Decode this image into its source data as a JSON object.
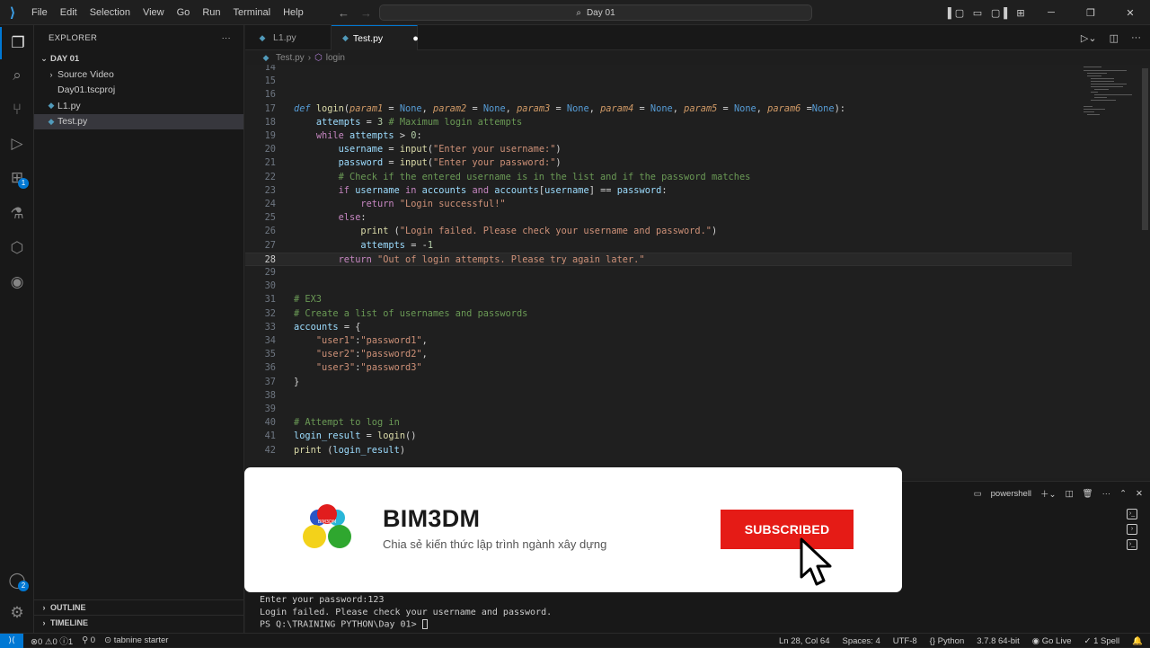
{
  "menu": [
    "File",
    "Edit",
    "Selection",
    "View",
    "Go",
    "Run",
    "Terminal",
    "Help"
  ],
  "command_center": "Day 01",
  "explorer": {
    "title": "EXPLORER",
    "folder": "DAY 01",
    "items": [
      {
        "label": "Source Video",
        "kind": "folder"
      },
      {
        "label": "Day01.tscproj",
        "kind": "file"
      },
      {
        "label": "L1.py",
        "kind": "py"
      },
      {
        "label": "Test.py",
        "kind": "py",
        "selected": true
      }
    ],
    "outline": "OUTLINE",
    "timeline": "TIMELINE"
  },
  "tabs": [
    {
      "label": "L1.py",
      "active": false
    },
    {
      "label": "Test.py",
      "active": true,
      "dirty": true
    }
  ],
  "breadcrumb": {
    "file": "Test.py",
    "symbol": "login"
  },
  "activity_badges": {
    "extensions": "1",
    "accounts": "2"
  },
  "code_lines": [
    {
      "n": "14",
      "html": ""
    },
    {
      "n": "15",
      "html": ""
    },
    {
      "n": "16",
      "html": ""
    },
    {
      "n": "17",
      "html": "<span class='def'>def</span> <span class='fn'>login</span><span class='plain'>(</span><span class='prm'>param1</span> <span class='op'>=</span> <span class='none'>None</span><span class='plain'>, </span><span class='prm'>param2</span> <span class='op'>=</span> <span class='none'>None</span><span class='plain'>, </span><span class='prm'>param3</span> <span class='op'>=</span> <span class='none'>None</span><span class='plain'>, </span><span class='prm'>param4</span> <span class='op'>=</span> <span class='none'>None</span><span class='plain'>, </span><span class='prm'>param5</span> <span class='op'>=</span> <span class='none'>None</span><span class='plain'>, </span><span class='prm'>param6</span> <span class='op'>=</span><span class='none'>None</span><span class='plain'>):</span>"
    },
    {
      "n": "18",
      "html": "    <span class='var'>attempts</span> <span class='op'>=</span> <span class='num'>3</span> <span class='cm'># Maximum login attempts</span>"
    },
    {
      "n": "19",
      "html": "    <span class='kw'>while</span> <span class='var'>attempts</span> <span class='op'>&gt;</span> <span class='num'>0</span><span class='plain'>:</span>"
    },
    {
      "n": "20",
      "html": "        <span class='var'>username</span> <span class='op'>=</span> <span class='fn'>input</span><span class='plain'>(</span><span class='str'>\"Enter your username:\"</span><span class='plain'>)</span>"
    },
    {
      "n": "21",
      "html": "        <span class='var'>password</span> <span class='op'>=</span> <span class='fn'>input</span><span class='plain'>(</span><span class='str'>\"Enter your password:\"</span><span class='plain'>)</span>"
    },
    {
      "n": "22",
      "html": "        <span class='cm'># Check if the entered username is in the list and if the password matches</span>"
    },
    {
      "n": "23",
      "html": "        <span class='kw'>if</span> <span class='var'>username</span> <span class='kw'>in</span> <span class='var'>accounts</span> <span class='kw'>and</span> <span class='var'>accounts</span><span class='plain'>[</span><span class='var'>username</span><span class='plain'>]</span> <span class='op'>==</span> <span class='var'>password</span><span class='plain'>:</span>"
    },
    {
      "n": "24",
      "html": "            <span class='kw'>return</span> <span class='str'>\"Login successful!\"</span>"
    },
    {
      "n": "25",
      "html": "        <span class='kw'>else</span><span class='plain'>:</span>"
    },
    {
      "n": "26",
      "html": "            <span class='fn'>print</span> <span class='plain'>(</span><span class='str'>\"Login failed. Please check your username and password.\"</span><span class='plain'>)</span>"
    },
    {
      "n": "27",
      "html": "            <span class='var'>attempts</span> <span class='op'>=</span> <span class='op'>-</span><span class='num'>1</span>"
    },
    {
      "n": "28",
      "html": "        <span class='kw'>return</span> <span class='str'>\"Out of login attempts. Please try again later.\"</span>",
      "current": true
    },
    {
      "n": "29",
      "html": ""
    },
    {
      "n": "30",
      "html": ""
    },
    {
      "n": "31",
      "html": "<span class='cm'># EX3</span>"
    },
    {
      "n": "32",
      "html": "<span class='cm'># Create a list of usernames and passwords</span>"
    },
    {
      "n": "33",
      "html": "<span class='var'>accounts</span> <span class='op'>=</span> <span class='plain'>{</span>"
    },
    {
      "n": "34",
      "html": "    <span class='str'>\"user1\"</span><span class='plain'>:</span><span class='str'>\"password1\"</span><span class='plain'>,</span>"
    },
    {
      "n": "35",
      "html": "    <span class='str'>\"user2\"</span><span class='plain'>:</span><span class='str'>\"password2\"</span><span class='plain'>,</span>"
    },
    {
      "n": "36",
      "html": "    <span class='str'>\"user3\"</span><span class='plain'>:</span><span class='str'>\"password3\"</span>"
    },
    {
      "n": "37",
      "html": "<span class='plain'>}</span>"
    },
    {
      "n": "38",
      "html": ""
    },
    {
      "n": "39",
      "html": ""
    },
    {
      "n": "40",
      "html": "<span class='cm'># Attempt to log in</span>"
    },
    {
      "n": "41",
      "html": "<span class='var'>login_result</span> <span class='op'>=</span> <span class='fn'>login</span><span class='plain'>()</span>"
    },
    {
      "n": "42",
      "html": "<span class='fn'>print</span> <span class='plain'>(</span><span class='var'>login_result</span><span class='plain'>)</span>"
    }
  ],
  "terminal": {
    "shell": "powershell",
    "lines": [
      "Enter your password:123",
      "Login failed. Please check your username and password.",
      "PS Q:\\TRAINING PYTHON\\Day 01> "
    ]
  },
  "overlay": {
    "brand": "BIM3DM",
    "tagline": "Chia sẻ kiến thức lập trình ngành xây dựng",
    "button": "SUBSCRIBED",
    "logo_text": "BIM3DM"
  },
  "status": {
    "errors": "0",
    "warnings": "0",
    "info": "1",
    "ports": "0",
    "tabnine": "tabnine starter",
    "position": "Ln 28, Col 64",
    "spaces": "Spaces: 4",
    "encoding": "UTF-8",
    "language": "Python",
    "interpreter": "3.7.8 64-bit",
    "golive": "Go Live",
    "spell": "1 Spell"
  },
  "colors": {
    "accent": "#0078d4",
    "subscribe": "#e51b16",
    "editor_bg": "#1f1f1f"
  }
}
